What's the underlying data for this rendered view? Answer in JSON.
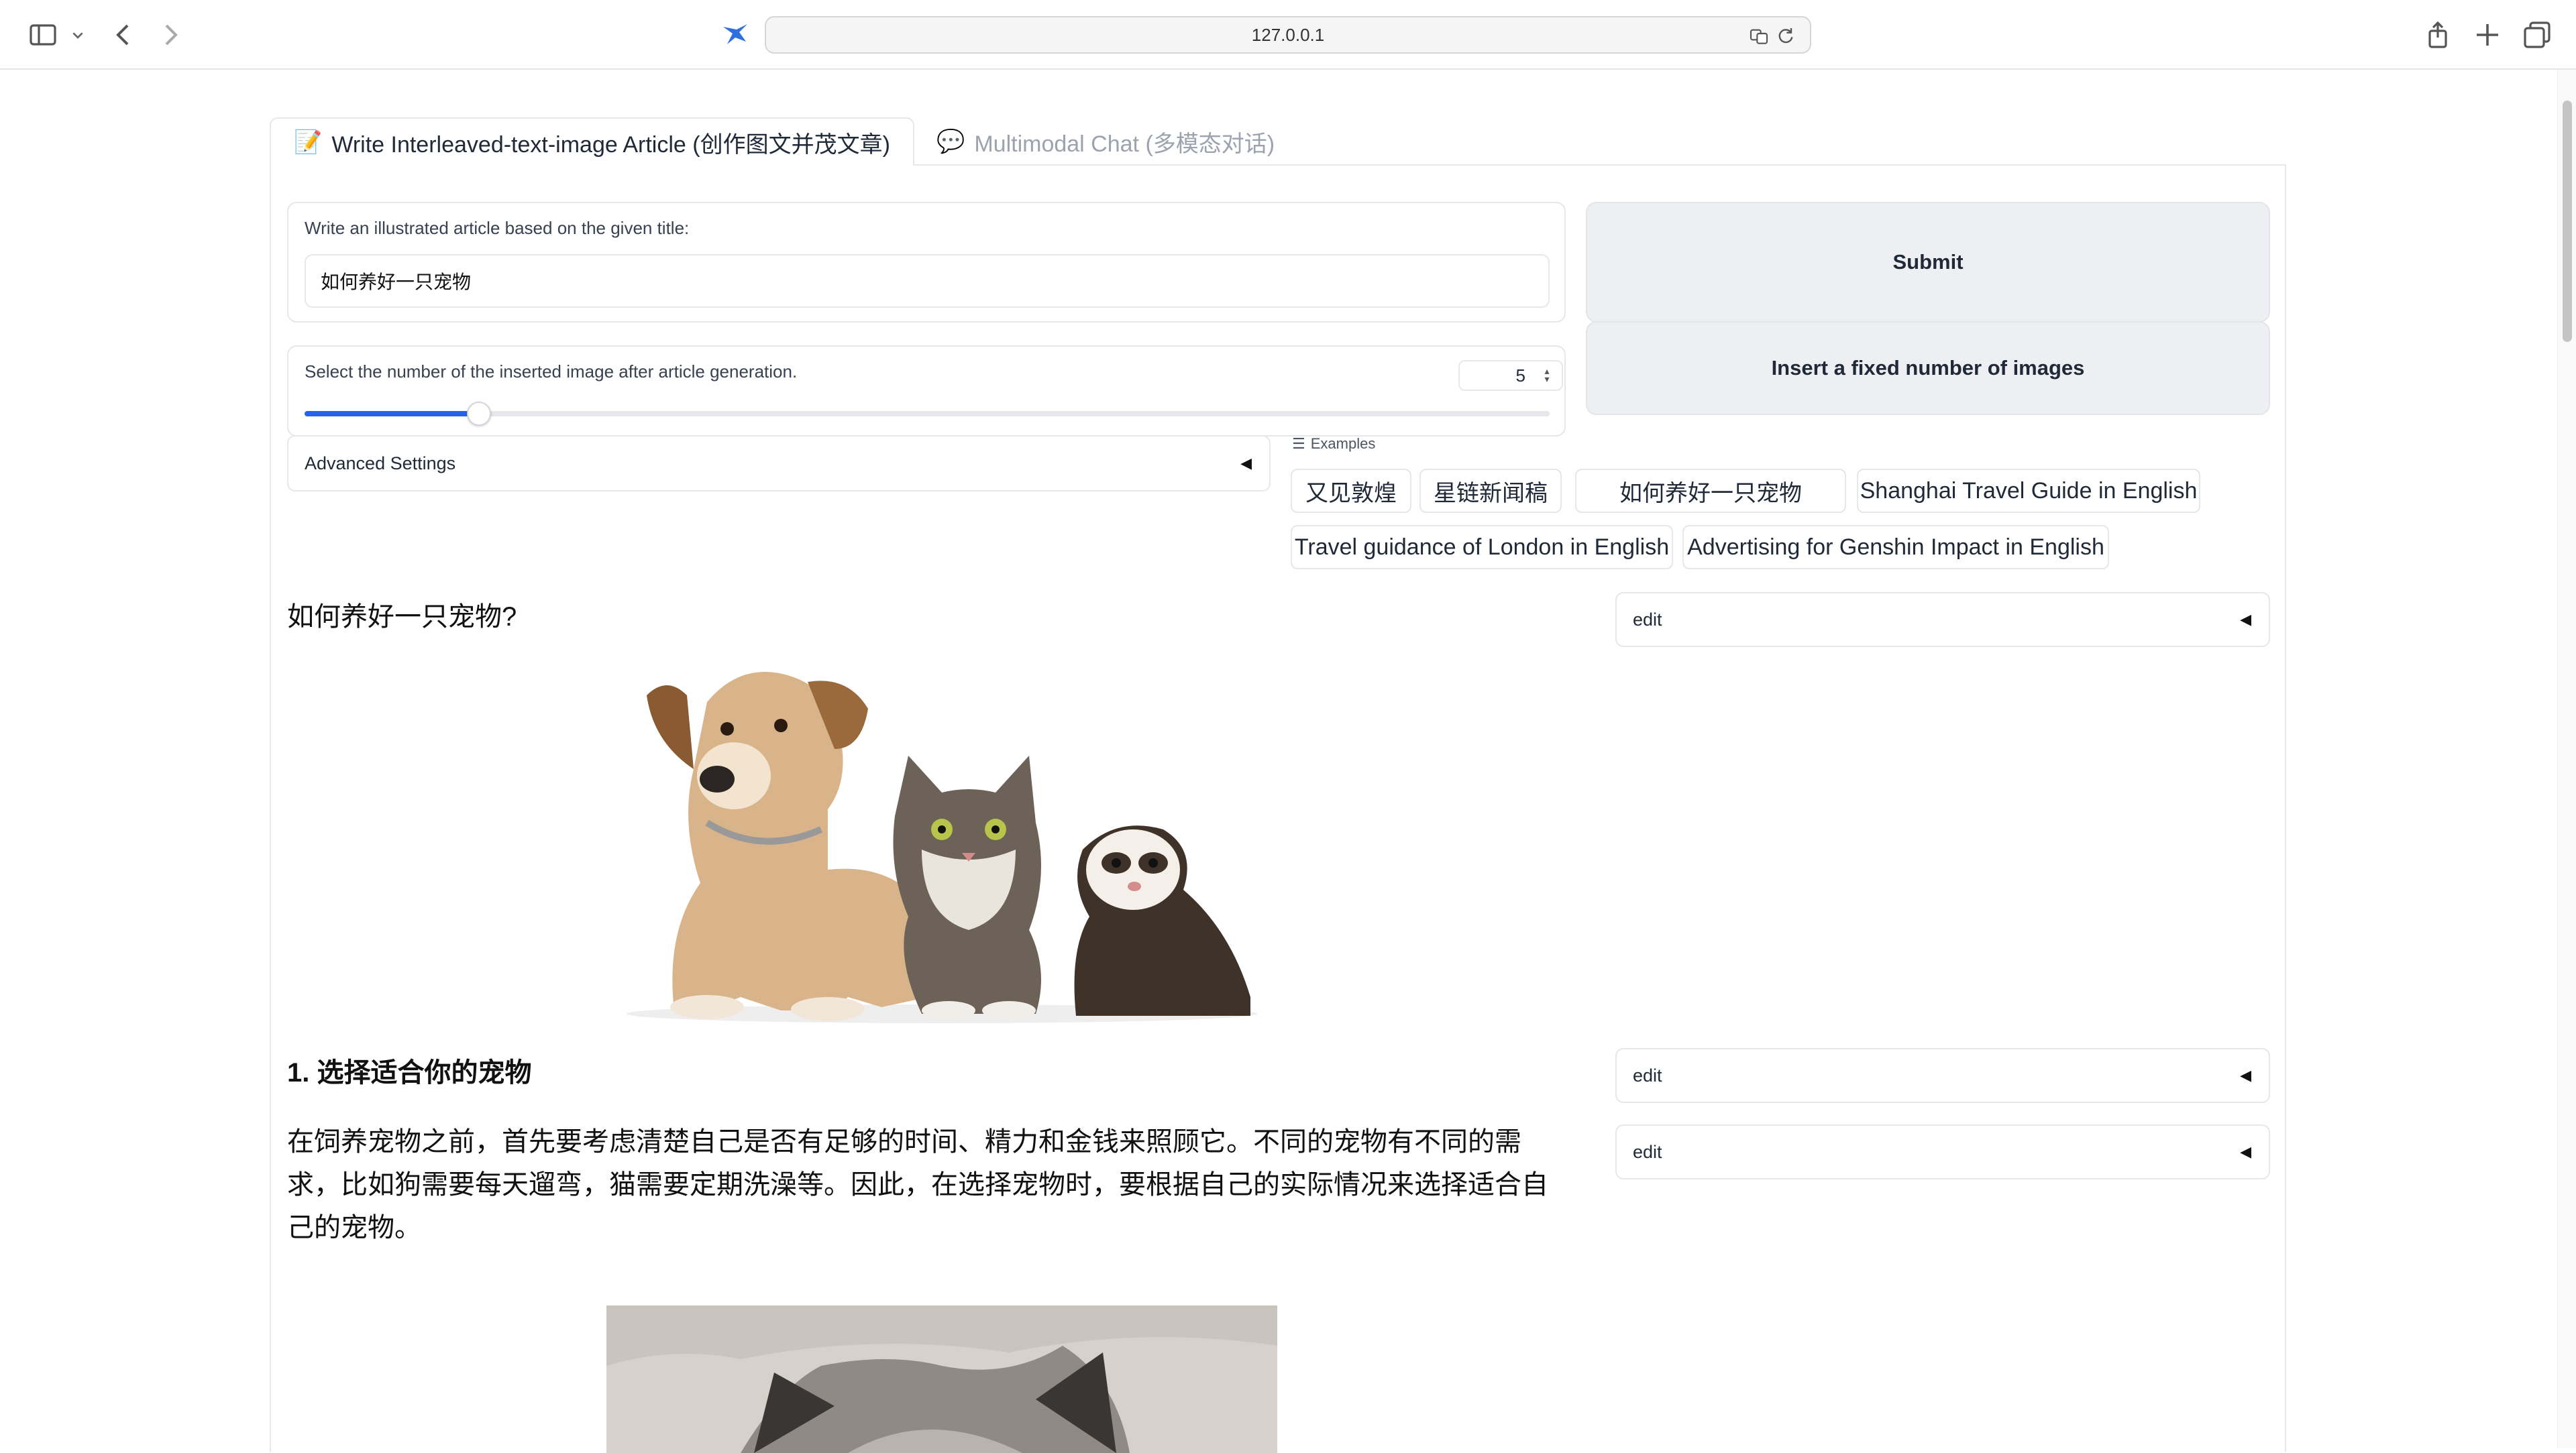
{
  "browser": {
    "url": "127.0.0.1",
    "icons": [
      "sidebar-icon",
      "chevron-down-icon",
      "back-icon",
      "forward-icon",
      "site-bird-icon",
      "translate-icon",
      "reload-icon",
      "share-icon",
      "new-tab-icon",
      "tabs-overview-icon"
    ]
  },
  "tabs": [
    {
      "emoji": "📝",
      "label": "Write Interleaved-text-image Article (创作图文并茂文章)",
      "active": true
    },
    {
      "emoji": "💬",
      "label": "Multimodal Chat (多模态对话)",
      "active": false
    }
  ],
  "form": {
    "title_label": "Write an illustrated article based on the given title:",
    "title_value": "如何养好一只宠物",
    "image_count_label": "Select the number of the inserted image after article generation.",
    "image_count_value": "5",
    "image_count_fraction": 0.14,
    "advanced_label": "Advanced Settings",
    "submit_label": "Submit",
    "insert_label": "Insert a fixed number of images"
  },
  "examples": {
    "label": "Examples",
    "items": [
      "又见敦煌",
      "星链新闻稿",
      "如何养好一只宠物",
      "Shanghai Travel Guide in English",
      "Travel guidance of London in English",
      "Advertising for Genshin Impact in English"
    ]
  },
  "article": {
    "title": "如何养好一只宠物?",
    "heading1": "1. 选择适合你的宠物",
    "para1_lines": [
      "在饲养宠物之前，首先要考虑清楚自己是否有足够的时间、精力和金钱来照顾它。不同的宠物有不同的需",
      "求，比如狗需要每天遛弯，猫需要定期洗澡等。因此，在选择宠物时，要根据自己的实际情况来选择适合自",
      "己的宠物。"
    ],
    "edit_labels": [
      "edit",
      "edit",
      "edit"
    ]
  },
  "colors": {
    "accent": "#2563eb",
    "button_bg": "#eeeff2",
    "border": "#e5e7eb",
    "inactive_tab": "#9ca3af"
  }
}
